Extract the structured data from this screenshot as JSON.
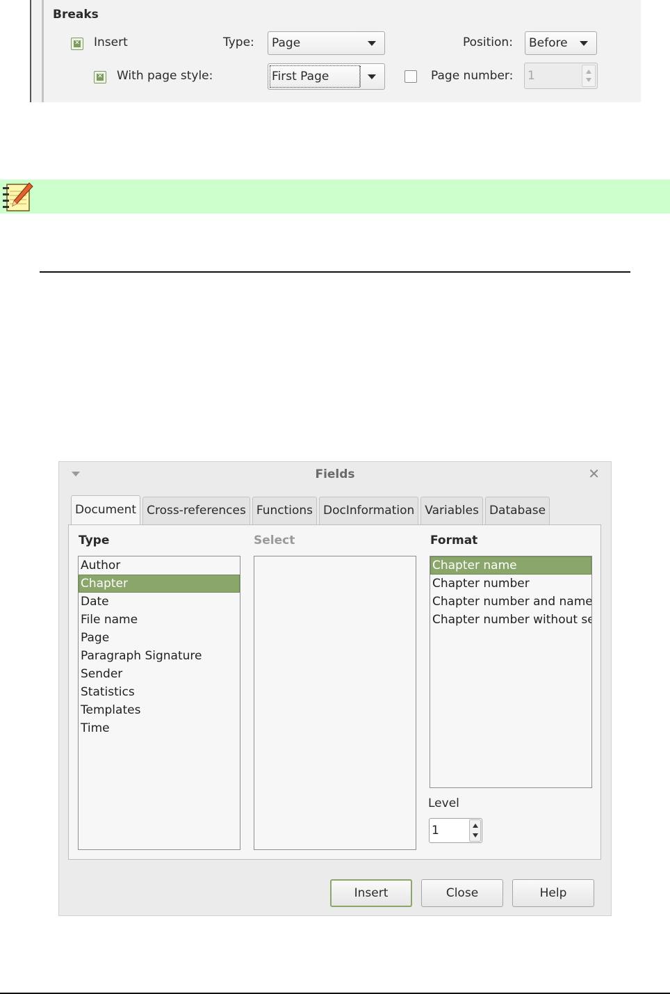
{
  "breaks": {
    "title": "Breaks",
    "insert_label": "Insert",
    "insert_checked": true,
    "type_label": "Type:",
    "type_value": "Page",
    "position_label": "Position:",
    "position_value": "Before",
    "with_page_style_label": "With page style:",
    "with_page_style_checked": true,
    "page_style_value": "First Page",
    "page_number_label": "Page number:",
    "page_number_checked": false,
    "page_number_value": "1"
  },
  "note": {
    "icon": "note-pad-pencil-icon",
    "background": "#ccffcc"
  },
  "dialog": {
    "title": "Fields",
    "tabs": [
      "Document",
      "Cross-references",
      "Functions",
      "DocInformation",
      "Variables",
      "Database"
    ],
    "active_tab": "Document",
    "type_header": "Type",
    "select_header": "Select",
    "format_header": "Format",
    "type_items": [
      "Author",
      "Chapter",
      "Date",
      "File name",
      "Page",
      "Paragraph Signature",
      "Sender",
      "Statistics",
      "Templates",
      "Time"
    ],
    "type_selected": "Chapter",
    "format_items": [
      "Chapter name",
      "Chapter number",
      "Chapter number and name",
      "Chapter number without sep"
    ],
    "format_selected": "Chapter name",
    "level_label": "Level",
    "level_value": "1",
    "buttons": {
      "insert": "Insert",
      "close": "Close",
      "help": "Help"
    },
    "accent_color": "#8aa66a"
  }
}
